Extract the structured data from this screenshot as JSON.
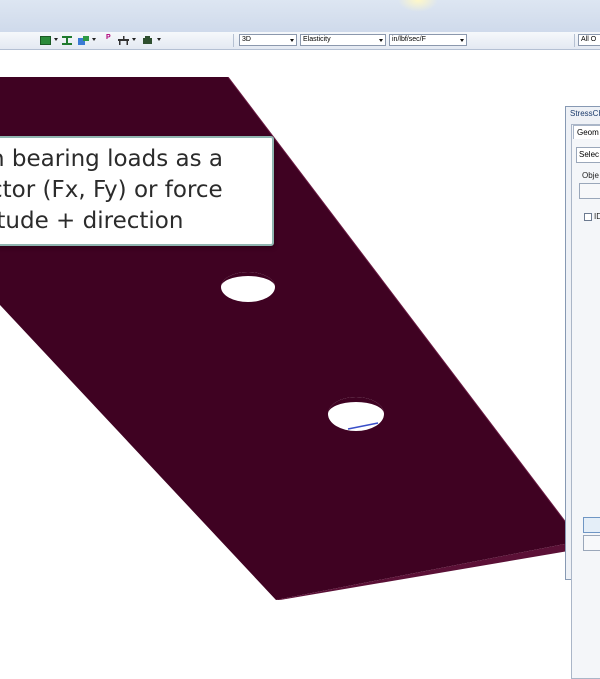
{
  "callout": {
    "lines": [
      "n bearing loads as a",
      "ctor (Fx, Fy) or force",
      "itude + direction"
    ]
  },
  "toolbar": {
    "view_combo": "3D",
    "result_combo": "Elasticity",
    "units_combo": "in/lbf/sec/F",
    "filter_combo": "All O"
  },
  "dialog": {
    "title": "StressCh",
    "tab": "Geom",
    "select_label": "Selec",
    "objects_label": "Obje",
    "checkbox_label": "ID"
  },
  "colors": {
    "plate": "#3f0222",
    "plate_edge": "#5b1036",
    "callout_border": "#8fb5b0"
  }
}
